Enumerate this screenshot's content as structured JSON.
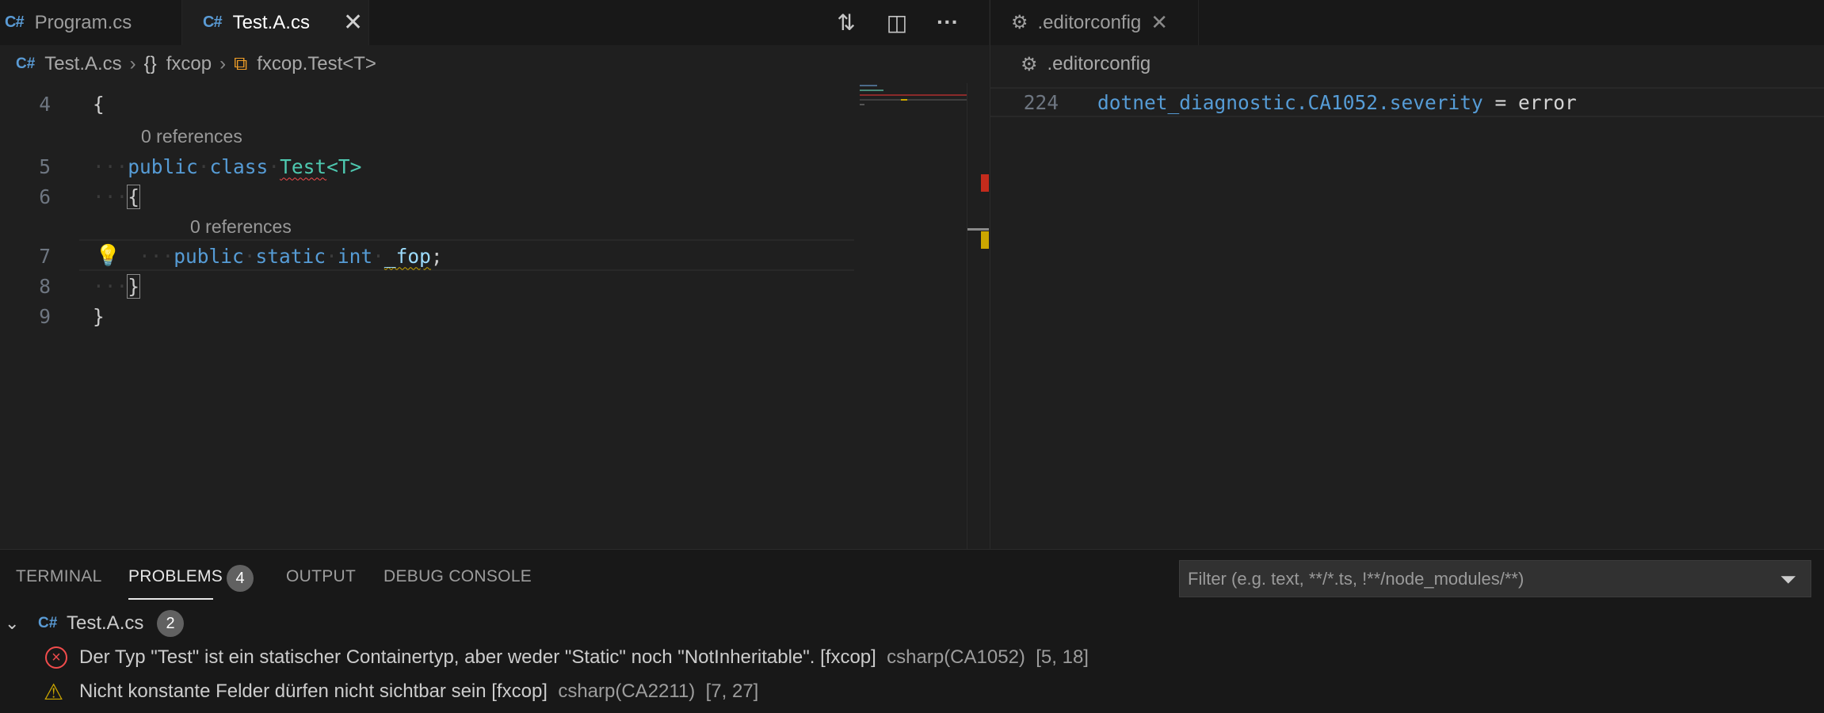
{
  "left_editor": {
    "tabs": [
      {
        "icon": "csharp-file-icon",
        "label": "Program.cs",
        "active": false
      },
      {
        "icon": "csharp-file-icon",
        "label": "Test.A.cs",
        "active": true
      }
    ],
    "tab_close_glyph": "✕",
    "toolbar": {
      "compare_icon": "⇅",
      "split_icon": "◫",
      "more_icon": "···"
    },
    "breadcrumb": {
      "file": "Test.A.cs",
      "namespace_icon": "{}",
      "namespace": "fxcop",
      "class": "fxcop.Test<T>"
    },
    "code_lines": [
      {
        "num": "4",
        "text": "{"
      },
      {
        "num": "5",
        "lens": "0 references",
        "kw1": "public",
        "kw2": "class",
        "type": "Test",
        "rest": "<T>"
      },
      {
        "num": "6",
        "bracket": "{"
      },
      {
        "num": "7",
        "lens": "0 references",
        "kw1": "public",
        "kw2": "static",
        "kw3": "int",
        "field": "_fop",
        "rest": ";"
      },
      {
        "num": "8",
        "bracket": "}"
      },
      {
        "num": "9",
        "text": "}"
      }
    ],
    "lightbulb_icon": "lightbulb-icon"
  },
  "right_editor": {
    "tab": {
      "icon": "gear-icon",
      "label": ".editorconfig"
    },
    "tab_close_glyph": "✕",
    "breadcrumb": ".editorconfig",
    "line": {
      "num": "224",
      "key": "dotnet_diagnostic.CA1052.severity",
      "op": " = ",
      "value": "error"
    }
  },
  "panel": {
    "tabs": [
      {
        "label": "TERMINAL"
      },
      {
        "label": "PROBLEMS",
        "active": true,
        "badge": "4"
      },
      {
        "label": "OUTPUT"
      },
      {
        "label": "DEBUG CONSOLE"
      }
    ],
    "filter_placeholder": "Filter (e.g. text, **/*.ts, !**/node_modules/**)",
    "file_group": {
      "label": "Test.A.cs",
      "count": "2"
    },
    "problems": [
      {
        "severity": "error",
        "message": "Der Typ \"Test\" ist ein statischer Containertyp, aber weder \"Static\" noch \"NotInheritable\". [fxcop]",
        "source": "csharp(CA1052)",
        "location": "[5, 18]"
      },
      {
        "severity": "warning",
        "message": "Nicht konstante Felder dürfen nicht sichtbar sein [fxcop]",
        "source": "csharp(CA2211)",
        "location": "[7, 27]"
      }
    ]
  },
  "colors": {
    "accent_error": "#f14c4c",
    "accent_warning": "#cca700",
    "keyword": "#569cd6",
    "type": "#4ec9b0",
    "field": "#9cdcfe"
  }
}
